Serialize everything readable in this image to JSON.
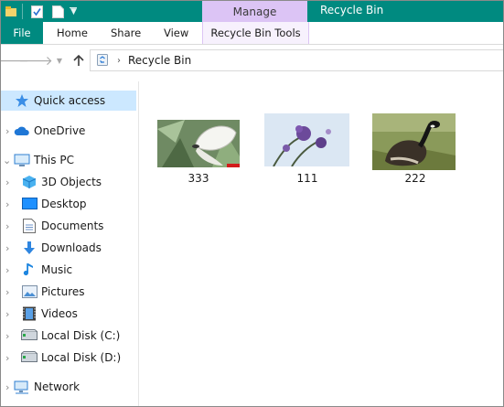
{
  "window": {
    "title": "Recycle Bin"
  },
  "ribbon": {
    "context_tab": "Manage",
    "tabs": {
      "file": "File",
      "home": "Home",
      "share": "Share",
      "view": "View",
      "tools": "Recycle Bin Tools"
    }
  },
  "address": {
    "path": "Recycle Bin"
  },
  "nav": {
    "quick_access": "Quick access",
    "onedrive": "OneDrive",
    "this_pc": "This PC",
    "objects3d": "3D Objects",
    "desktop": "Desktop",
    "documents": "Documents",
    "downloads": "Downloads",
    "music": "Music",
    "pictures": "Pictures",
    "videos": "Videos",
    "disk_c": "Local Disk (C:)",
    "disk_d": "Local Disk (D:)",
    "network": "Network"
  },
  "files": [
    {
      "name": "333",
      "icon": "butterfly-thumbnail"
    },
    {
      "name": "111",
      "icon": "flower-thumbnail"
    },
    {
      "name": "222",
      "icon": "goose-thumbnail"
    }
  ],
  "colors": {
    "accent": "#008a80",
    "manage_tab": "#dcc4f5",
    "selection": "#cce8ff"
  }
}
